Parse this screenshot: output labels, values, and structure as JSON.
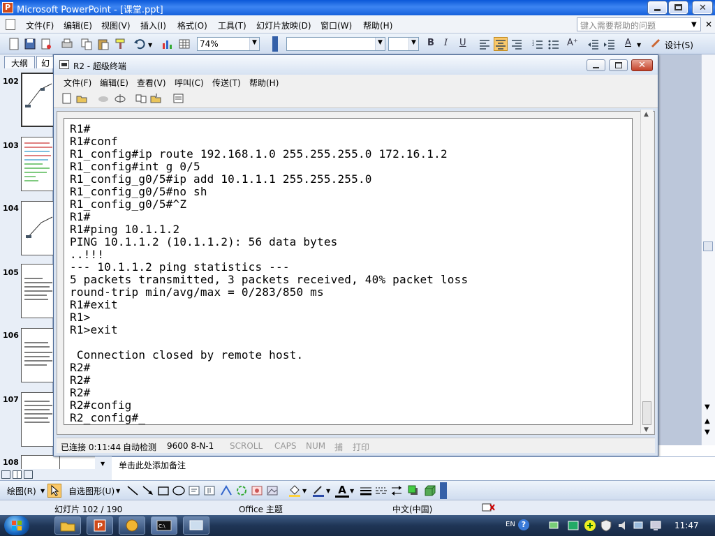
{
  "powerpoint": {
    "title": "Microsoft PowerPoint - [课堂.ppt]",
    "menu": [
      "文件(F)",
      "编辑(E)",
      "视图(V)",
      "插入(I)",
      "格式(O)",
      "工具(T)",
      "幻灯片放映(D)",
      "窗口(W)",
      "帮助(H)"
    ],
    "help_placeholder": "键入需要帮助的问题",
    "zoom": "74%",
    "design_label": "设计(S)",
    "outline_tab": "大纲",
    "slides_tab": "幻",
    "slide_numbers": [
      "102",
      "103",
      "104",
      "105",
      "106",
      "107",
      "108"
    ],
    "notes_placeholder": "单击此处添加备注",
    "draw_label": "绘图(R)",
    "autoshape_label": "自选图形(U)",
    "status": {
      "slide": "幻灯片 102 / 190",
      "theme": "Office 主题",
      "language": "中文(中国)"
    }
  },
  "hyperterminal": {
    "title": "R2 - 超级终端",
    "menu": [
      "文件(F)",
      "编辑(E)",
      "查看(V)",
      "呼叫(C)",
      "传送(T)",
      "帮助(H)"
    ],
    "terminal_lines": [
      "R1#",
      "R1#conf",
      "R1_config#ip route 192.168.1.0 255.255.255.0 172.16.1.2",
      "R1_config#int g 0/5",
      "R1_config_g0/5#ip add 10.1.1.1 255.255.255.0",
      "R1_config_g0/5#no sh",
      "R1_config_g0/5#^Z",
      "R1#",
      "R1#ping 10.1.1.2",
      "PING 10.1.1.2 (10.1.1.2): 56 data bytes",
      "..!!!",
      "--- 10.1.1.2 ping statistics ---",
      "5 packets transmitted, 3 packets received, 40% packet loss",
      "round-trip min/avg/max = 0/283/850 ms",
      "R1#exit",
      "R1>",
      "R1>exit",
      "",
      " Connection closed by remote host.",
      "R2#",
      "R2#",
      "R2#",
      "R2#config",
      "R2_config#_"
    ],
    "status": {
      "connected": "已连接 0:11:44",
      "detect": "自动检测",
      "baud": "9600 8-N-1",
      "scroll": "SCROLL",
      "caps": "CAPS",
      "num": "NUM",
      "capture": "捕",
      "print": "打印"
    }
  },
  "taskbar": {
    "lang": "EN",
    "clock": "11:47"
  },
  "colors": {
    "xp_title_blue": "#1560dc",
    "terminal_bg": "#ffffff",
    "taskbar": "#1f3556"
  }
}
